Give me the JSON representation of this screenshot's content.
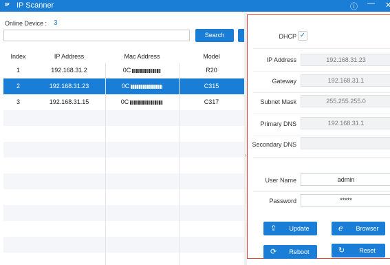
{
  "app": {
    "logo": "IP",
    "title": "IP Scanner",
    "icons": {
      "info": "info-icon",
      "minimize": "minimize-icon",
      "close": "close-icon"
    }
  },
  "left": {
    "online_label": "Online Device :",
    "online_count": "3",
    "search_placeholder": "",
    "search_button": "Search",
    "columns": [
      "Index",
      "IP Address",
      "Mac Address",
      "Model"
    ],
    "devices": [
      {
        "index": "1",
        "ip": "192.168.31.2",
        "mac": "0C",
        "model": "R20",
        "selected": false
      },
      {
        "index": "2",
        "ip": "192.168.31.23",
        "mac": "0C",
        "model": "C315",
        "selected": true
      },
      {
        "index": "3",
        "ip": "192.168.31.15",
        "mac": "0C",
        "model": "C317",
        "selected": false
      }
    ]
  },
  "right": {
    "dhcp_label": "DHCP",
    "dhcp_checked": true,
    "ip_label": "IP Address",
    "ip_value": "192.168.31.23",
    "gateway_label": "Gateway",
    "gateway_value": "192.168.31.1",
    "subnet_label": "Subnet Mask",
    "subnet_value": "255.255.255.0",
    "dns1_label": "Primary DNS",
    "dns1_value": "192.168.31.1",
    "dns2_label": "Secondary DNS",
    "dns2_value": "",
    "username_label": "User Name",
    "username_value": "admin",
    "password_label": "Password",
    "password_value": "*****",
    "update_button": "Update",
    "browser_button": "Browser",
    "reboot_button": "Reboot",
    "reset_button": "Reset"
  },
  "colors": {
    "accent": "#1a7ed6",
    "highlight_border": "#e8452e"
  }
}
